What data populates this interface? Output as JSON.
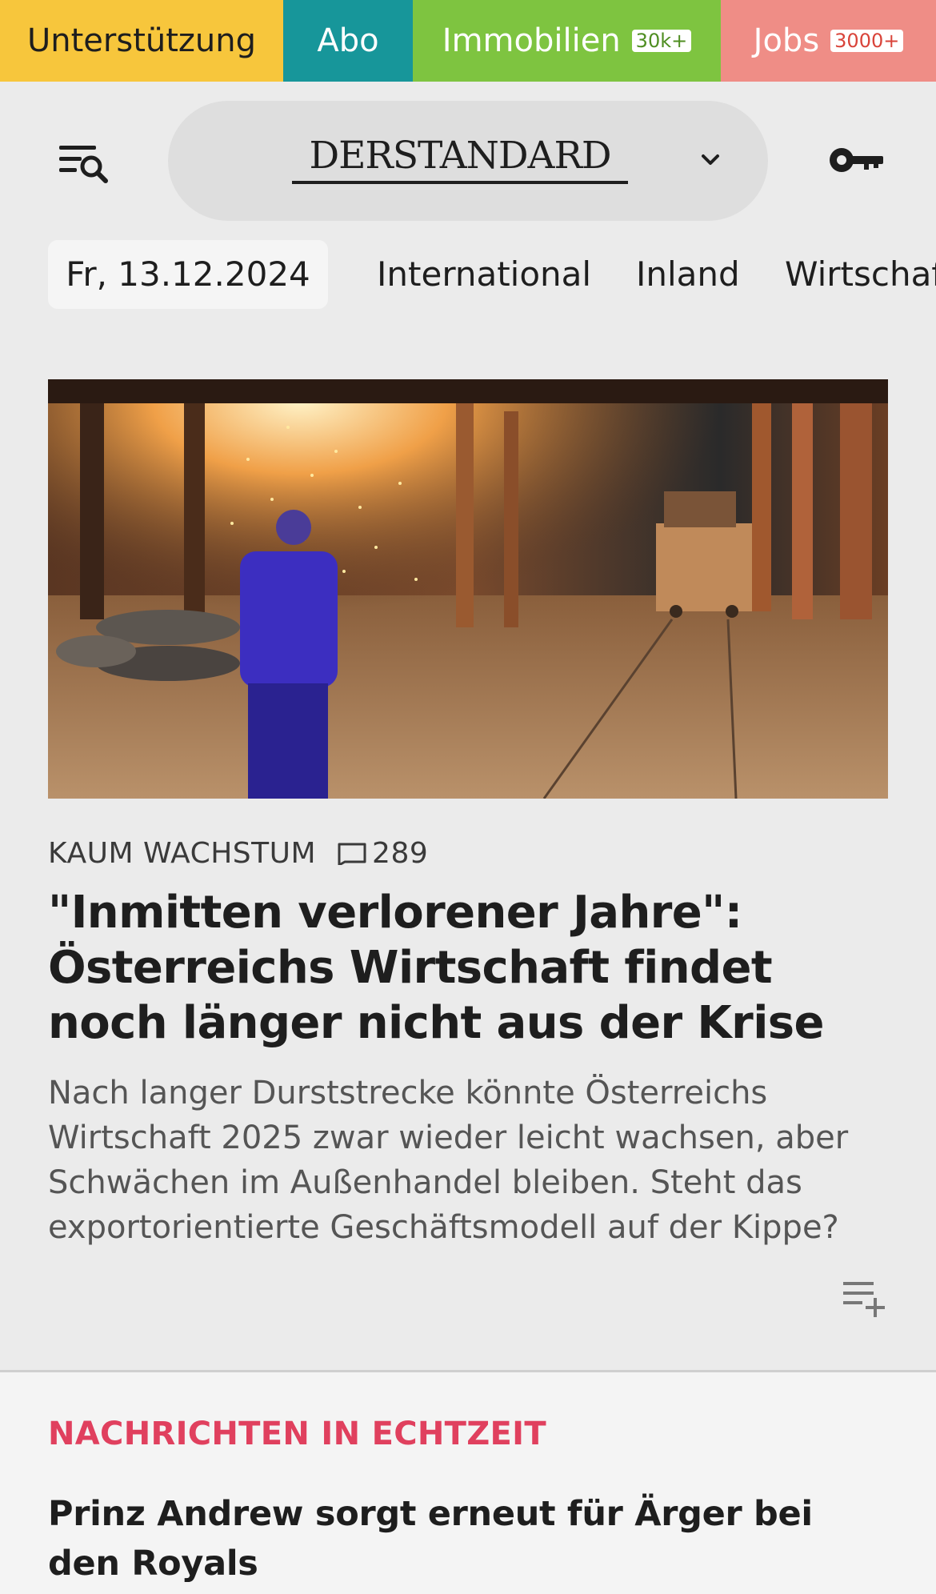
{
  "topbar": {
    "support": "Unterstützung",
    "abo": "Abo",
    "immobilien": "Immobilien",
    "immobilien_badge": "30k+",
    "jobs": "Jobs",
    "jobs_badge": "3000+"
  },
  "header": {
    "logo": "DERSTANDARD",
    "menu_icon": "menu-search-icon",
    "dropdown_icon": "chevron-down-icon",
    "login_icon": "key-icon"
  },
  "nav": {
    "date": "Fr, 13.12.2024",
    "items": [
      "International",
      "Inland",
      "Wirtschaft"
    ]
  },
  "article": {
    "kicker": "KAUM WACHSTUM",
    "comment_count": "289",
    "headline": "\"Inmitten verlorener Jahre\": Österreichs Wirtschaft findet noch länger nicht aus der Krise",
    "teaser": "Nach langer Durststrecke könnte Österreichs Wirtschaft 2025 zwar wieder leicht wachsen, aber Schwächen im Außenhandel bleiben. Steht das exportorientierte Geschäftsmodell auf der Kippe?",
    "add_to_list_icon": "playlist-add-icon"
  },
  "live": {
    "label": "NACHRICHTEN IN ECHTZEIT",
    "title": "Prinz Andrew sorgt erneut für Ärger bei den Royals"
  },
  "colors": {
    "support": "#f7c63c",
    "abo": "#17969a",
    "immobilien": "#7ec440",
    "jobs": "#ef8d86",
    "live_accent": "#e0405e"
  }
}
